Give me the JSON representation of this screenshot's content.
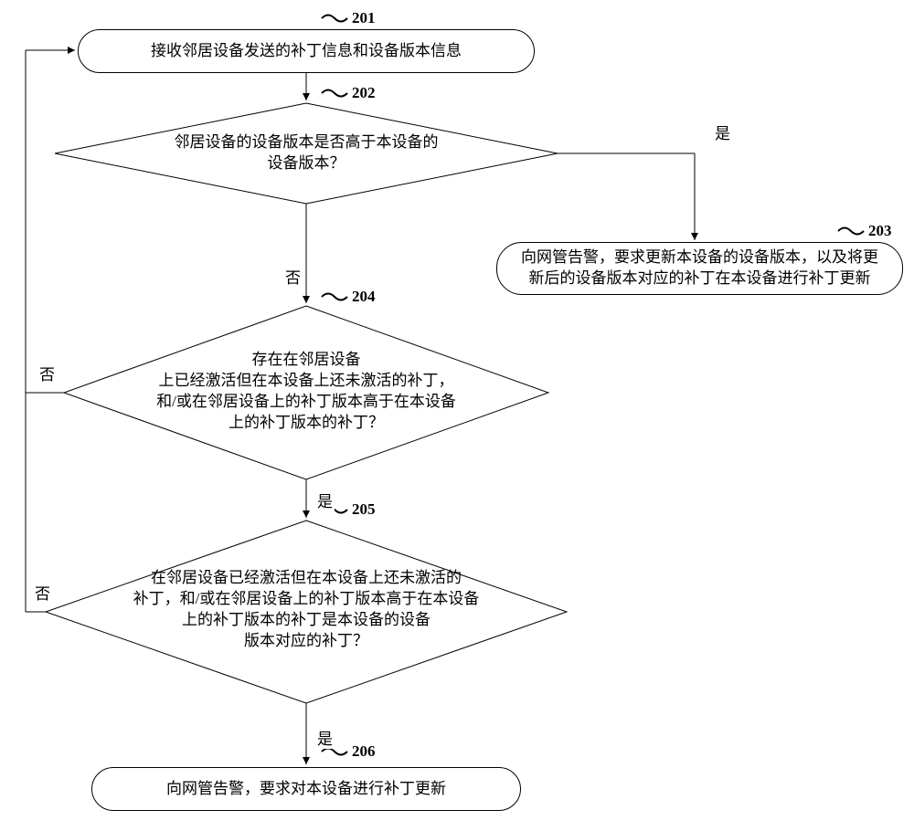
{
  "chart_data": {
    "type": "flowchart",
    "nodes": [
      {
        "id": "201",
        "type": "terminator",
        "text": "接收邻居设备发送的补丁信息和设备版本信息"
      },
      {
        "id": "202",
        "type": "decision",
        "text": "邻居设备的设备版本是否高于本设备的设备版本？"
      },
      {
        "id": "203",
        "type": "terminator",
        "text": "向网管告警，要求更新本设备的设备版本，以及将更新后的设备版本对应的补丁在本设备进行补丁更新"
      },
      {
        "id": "204",
        "type": "decision",
        "text": "存在在邻居设备上已经激活但在本设备上还未激活的补丁，和/或在邻居设备上的补丁版本高于在本设备上的补丁版本的补丁？"
      },
      {
        "id": "205",
        "type": "decision",
        "text": "在邻居设备已经激活但在本设备上还未激活的补丁，和/或在邻居设备上的补丁版本高于在本设备上的补丁版本的补丁是本设备的设备版本对应的补丁？"
      },
      {
        "id": "206",
        "type": "terminator",
        "text": "向网管告警，要求对本设备进行补丁更新"
      }
    ],
    "edges": [
      {
        "from": "201",
        "to": "202",
        "label": ""
      },
      {
        "from": "202",
        "to": "203",
        "label": "是"
      },
      {
        "from": "202",
        "to": "204",
        "label": "否"
      },
      {
        "from": "204",
        "to": "205",
        "label": "是"
      },
      {
        "from": "204",
        "to": "201",
        "label": "否"
      },
      {
        "from": "205",
        "to": "206",
        "label": "是"
      },
      {
        "from": "205",
        "to": "201",
        "label": "否"
      }
    ]
  },
  "steps": {
    "s201": "201",
    "s202": "202",
    "s203": "203",
    "s204": "204",
    "s205": "205",
    "s206": "206"
  },
  "node_text": {
    "n201": "接收邻居设备发送的补丁信息和设备版本信息",
    "n202_l1": "邻居设备的设备版本是否高于本设备的",
    "n202_l2": "设备版本？",
    "n203_l1": "向网管告警，要求更新本设备的设备版本，以及将更",
    "n203_l2": "新后的设备版本对应的补丁在本设备进行补丁更新",
    "n204_l1": "存在在邻居设备",
    "n204_l2": "上已经激活但在本设备上还未激活的补丁，",
    "n204_l3": "和/或在邻居设备上的补丁版本高于在本设备",
    "n204_l4": "上的补丁版本的补丁？",
    "n205_l1": "在邻居设备已经激活但在本设备上还未激活的",
    "n205_l2": "补丁，和/或在邻居设备上的补丁版本高于在本设备",
    "n205_l3": "上的补丁版本的补丁是本设备的设备",
    "n205_l4": "版本对应的补丁？",
    "n206": "向网管告警，要求对本设备进行补丁更新"
  },
  "edge_labels": {
    "yes": "是",
    "no": "否"
  }
}
